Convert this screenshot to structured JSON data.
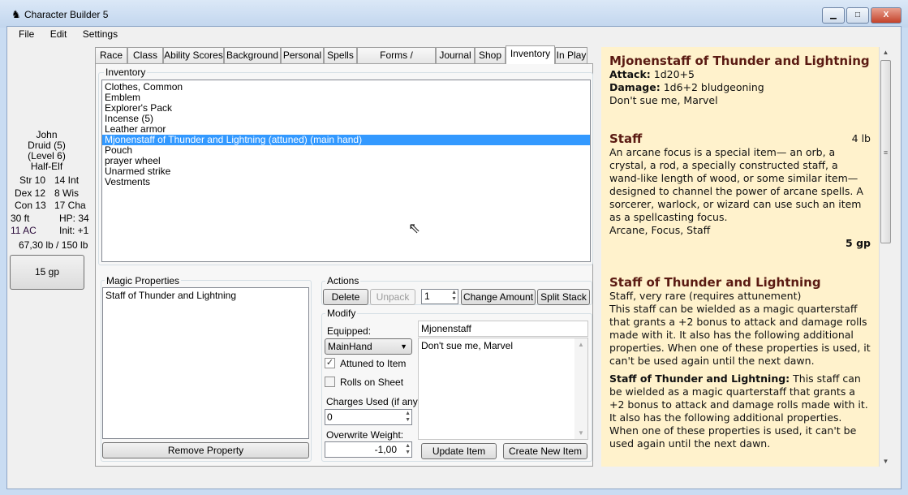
{
  "window": {
    "title": "Character Builder 5"
  },
  "menu": [
    "File",
    "Edit",
    "Settings"
  ],
  "character": {
    "name": "John",
    "class": "Druid (5)",
    "level": "(Level 6)",
    "race": "Half-Elf",
    "stats": [
      [
        "Str 10",
        "14 Int"
      ],
      [
        "Dex 12",
        "8 Wis"
      ],
      [
        "Con 13",
        "17 Cha"
      ]
    ],
    "speed": "30 ft",
    "hp": "HP: 34",
    "ac": "11 AC",
    "init": "Init: +1",
    "weight": "67,30 lb / 150 lb",
    "gold": "15 gp"
  },
  "tabs": [
    "Race",
    "Class",
    "Ability Scores",
    "Background",
    "Personal",
    "Spells",
    "Forms / Summons",
    "Journal",
    "Shop",
    "Inventory",
    "In Play"
  ],
  "selected_tab": "Inventory",
  "inventory": {
    "label": "Inventory",
    "items": [
      "Clothes, Common",
      "Emblem",
      "Explorer's Pack",
      "Incense (5)",
      "Leather armor",
      "Mjonenstaff of Thunder and Lightning (attuned) (main hand)",
      "Pouch",
      "prayer wheel",
      "Unarmed strike",
      "Vestments"
    ],
    "selected_index": 5
  },
  "magic": {
    "label": "Magic Properties",
    "items": [
      "Staff of Thunder and Lightning"
    ],
    "remove_button": "Remove Property"
  },
  "actions": {
    "label": "Actions",
    "delete": "Delete",
    "unpack": "Unpack",
    "amount": "1",
    "change_amount": "Change Amount",
    "split_stack": "Split Stack"
  },
  "modify": {
    "label": "Modify",
    "equipped_label": "Equipped:",
    "equipped_value": "MainHand",
    "attuned_label": "Attuned to Item",
    "attuned": true,
    "rolls_label": "Rolls on Sheet",
    "rolls": false,
    "charges_label": "Charges Used (if any):",
    "charges_value": "0",
    "weight_label": "Overwrite Weight:",
    "weight_value": "-1,00",
    "name_value": "Mjonenstaff",
    "desc_value": "Don't sue me, Marvel",
    "update_button": "Update Item",
    "create_button": "Create New Item"
  },
  "detail": {
    "title": "Mjonenstaff of Thunder and Lightning",
    "attack_label": "Attack:",
    "attack": "1d20+5",
    "damage_label": "Damage:",
    "damage": "1d6+2 bludgeoning",
    "note": "Don't sue me, Marvel",
    "base_title": "Staff",
    "base_weight": "4 lb",
    "base_desc": "An arcane focus is a special item— an orb, a crystal, a rod, a specially constructed staff, a wand-like length of wood, or some similar item— designed to channel the power of arcane spells. A sorcerer, warlock, or wizard can use such an item as a spellcasting focus.",
    "base_tags": "Arcane, Focus, Staff",
    "base_cost": "5 gp",
    "magic_title": "Staff of Thunder and Lightning",
    "magic_type": "Staff, very rare (requires attunement)",
    "magic_desc": "This staff can be wielded as a magic quarterstaff that grants a +2 bonus to attack and damage rolls made with it. It also has the following additional properties. When one of these properties is used, it can't be used again until the next dawn.",
    "magic_prop_label": "Staff of Thunder and Lightning:",
    "magic_prop_desc": "This staff can be wielded as a magic quarterstaff that grants a +2 bonus to attack and damage rolls made with it. It also has the following additional properties. When one of these properties is used, it can't be used again until the next dawn."
  },
  "colors": {
    "selection": "#3399ff",
    "detail_bg": "#fff2cc",
    "detail_heading": "#5a1a12"
  }
}
